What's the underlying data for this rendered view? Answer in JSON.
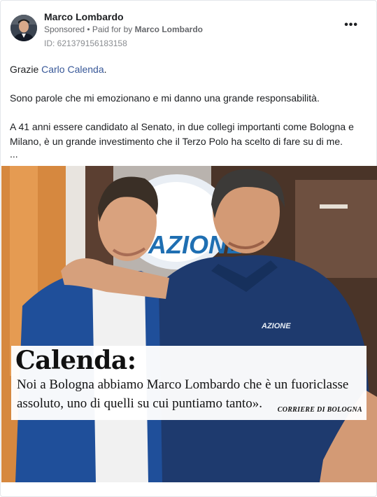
{
  "post": {
    "author": "Marco Lombardo",
    "sponsored": "Sponsored",
    "paid_prefix": "• Paid for by",
    "paid_by": "Marco Lombardo",
    "ad_id": "ID: 621379156183158",
    "more_label": "•••",
    "text": {
      "line1_prefix": "Grazie ",
      "line1_link": "Carlo Calenda",
      "line1_suffix": ".",
      "para2": "Sono parole che mi emozionano e mi danno una grande responsabilità.",
      "para3": "A 41 anni essere candidato al Senato, in due collegi importanti come Bologna e Milano, è un grande investimento che il Terzo Polo ha scelto di fare su di me.",
      "ellipsis": "..."
    }
  },
  "media": {
    "sign_text": "AZIONE",
    "shirt_logo": "AZIONE",
    "quote_title": "Calenda:",
    "quote_line1": "Noi a Bologna abbiamo Marco Lombardo che è un fuoriclasse",
    "quote_line2": "assoluto, uno di quelli su cui puntiamo tanto».",
    "quote_source": "CORRIERE DI BOLOGNA"
  },
  "icons": [
    "avatar",
    "more-options-icon"
  ]
}
